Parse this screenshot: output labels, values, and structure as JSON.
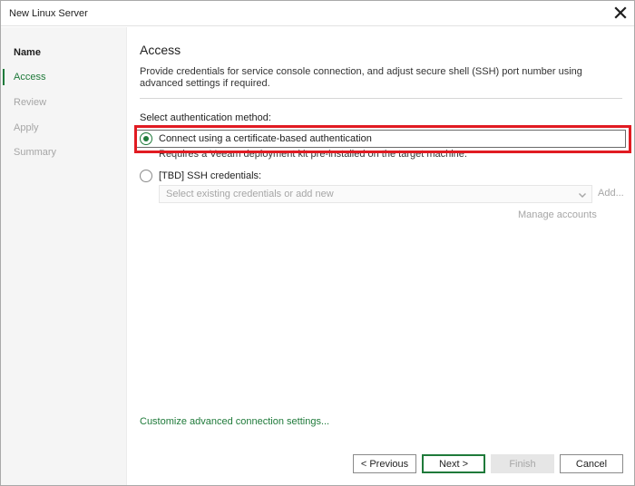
{
  "window": {
    "title": "New Linux Server"
  },
  "sidebar": {
    "steps": [
      {
        "label": "Name"
      },
      {
        "label": "Access"
      },
      {
        "label": "Review"
      },
      {
        "label": "Apply"
      },
      {
        "label": "Summary"
      }
    ]
  },
  "main": {
    "title": "Access",
    "description": "Provide credentials for service console connection, and adjust secure shell (SSH) port number using advanced settings if required.",
    "auth_label": "Select authentication method:",
    "option_cert": {
      "label": "Connect using a certificate-based authentication",
      "selected": true
    },
    "cert_hint": "Requires a Veeam deployment kit pre-installed on the target machine.",
    "option_ssh": {
      "label": "[TBD] SSH credentials:",
      "selected": false
    },
    "credentials_placeholder": "Select existing credentials or add new",
    "add_label": "Add...",
    "manage_label": "Manage accounts",
    "advanced_link": "Customize advanced connection settings..."
  },
  "footer": {
    "previous": "< Previous",
    "next": "Next >",
    "finish": "Finish",
    "cancel": "Cancel"
  },
  "colors": {
    "accent": "#1f7a3a",
    "highlight": "#e11b22",
    "disabled_text": "#a6a6a6"
  },
  "icons": {
    "close": "close-icon",
    "dropdown": "chevron-down-icon"
  }
}
